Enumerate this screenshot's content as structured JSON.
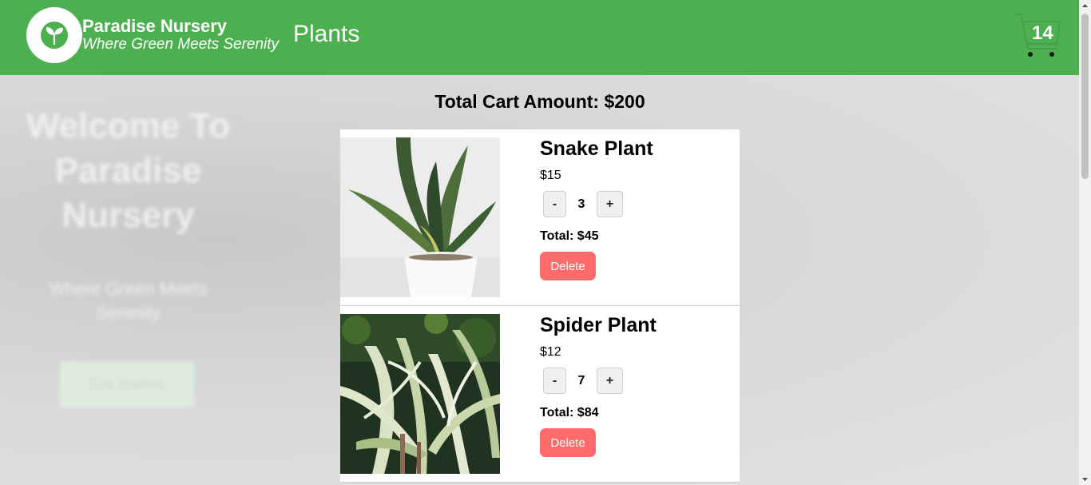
{
  "navbar": {
    "brand_name": "Paradise Nursery",
    "brand_tagline": "Where Green Meets Serenity",
    "plants_link": "Plants",
    "cart_count": "14",
    "background_color": "#4caf50"
  },
  "background_page": {
    "welcome_title": "Welcome To Paradise Nursery",
    "welcome_subtitle": "Where Green Meets Serenity",
    "get_started_label": "Get Started"
  },
  "cart": {
    "total_label": "Total Cart Amount: $200",
    "items": [
      {
        "name": "Snake Plant",
        "cost": "$15",
        "quantity": "3",
        "decrement_label": "-",
        "increment_label": "+",
        "subtotal": "Total: $45",
        "delete_label": "Delete",
        "image": "snake-plant-photo"
      },
      {
        "name": "Spider Plant",
        "cost": "$12",
        "quantity": "7",
        "decrement_label": "-",
        "increment_label": "+",
        "subtotal": "Total: $84",
        "delete_label": "Delete",
        "image": "spider-plant-photo"
      }
    ]
  },
  "colors": {
    "delete_button": "#ff6b6b",
    "card_background": "#ffffff"
  },
  "icons": [
    "sprout-logo-icon",
    "cart-icon"
  ]
}
